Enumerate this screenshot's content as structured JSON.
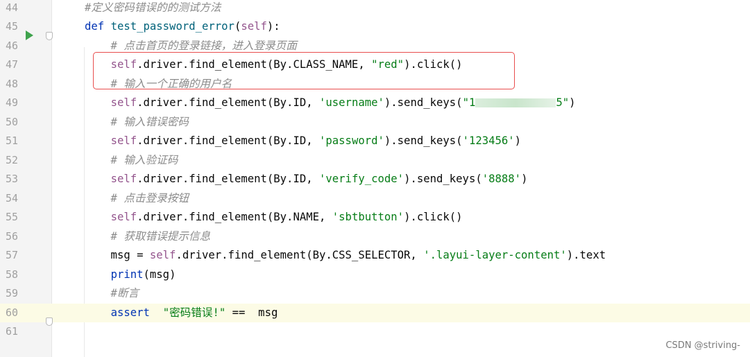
{
  "lines": [
    {
      "num": "44",
      "tokens": [
        {
          "t": "#定义密码错误的的测试方法",
          "c": "cmt"
        }
      ]
    },
    {
      "num": "45",
      "tokens": [
        {
          "t": "def ",
          "c": "kw"
        },
        {
          "t": "test_password_error",
          "c": "fn"
        },
        {
          "t": "(",
          "c": ""
        },
        {
          "t": "self",
          "c": "slf"
        },
        {
          "t": "):",
          "c": ""
        }
      ]
    },
    {
      "num": "46",
      "tokens": [
        {
          "t": "    # 点击首页的登录链接，进入登录页面",
          "c": "cmt"
        }
      ]
    },
    {
      "num": "47",
      "tokens": [
        {
          "t": "    ",
          "c": ""
        },
        {
          "t": "self",
          "c": "slf"
        },
        {
          "t": ".driver.find_element(By.CLASS_NAME, ",
          "c": ""
        },
        {
          "t": "\"red\"",
          "c": "str"
        },
        {
          "t": ").click()",
          "c": ""
        }
      ]
    },
    {
      "num": "48",
      "tokens": [
        {
          "t": "    # 输入一个正确的用户名",
          "c": "cmt"
        }
      ]
    },
    {
      "num": "49",
      "tokens": [
        {
          "t": "    ",
          "c": ""
        },
        {
          "t": "self",
          "c": "slf"
        },
        {
          "t": ".driver.find_element(By.ID, ",
          "c": ""
        },
        {
          "t": "'username'",
          "c": "str"
        },
        {
          "t": ").send_keys(",
          "c": ""
        },
        {
          "t": "\"1",
          "c": "str"
        },
        {
          "t": "",
          "c": "blur"
        },
        {
          "t": "5\"",
          "c": "str"
        },
        {
          "t": ")",
          "c": ""
        }
      ]
    },
    {
      "num": "50",
      "tokens": [
        {
          "t": "    # 输入错误密码",
          "c": "cmt"
        }
      ]
    },
    {
      "num": "51",
      "tokens": [
        {
          "t": "    ",
          "c": ""
        },
        {
          "t": "self",
          "c": "slf"
        },
        {
          "t": ".driver.find_element(By.ID, ",
          "c": ""
        },
        {
          "t": "'password'",
          "c": "str"
        },
        {
          "t": ").send_keys(",
          "c": ""
        },
        {
          "t": "'123456'",
          "c": "str"
        },
        {
          "t": ")",
          "c": ""
        }
      ]
    },
    {
      "num": "52",
      "tokens": [
        {
          "t": "    # 输入验证码",
          "c": "cmt"
        }
      ]
    },
    {
      "num": "53",
      "tokens": [
        {
          "t": "    ",
          "c": ""
        },
        {
          "t": "self",
          "c": "slf"
        },
        {
          "t": ".driver.find_element(By.ID, ",
          "c": ""
        },
        {
          "t": "'verify_code'",
          "c": "str"
        },
        {
          "t": ").send_keys(",
          "c": ""
        },
        {
          "t": "'8888'",
          "c": "str"
        },
        {
          "t": ")",
          "c": ""
        }
      ]
    },
    {
      "num": "54",
      "tokens": [
        {
          "t": "    # 点击登录按钮",
          "c": "cmt"
        }
      ]
    },
    {
      "num": "55",
      "tokens": [
        {
          "t": "    ",
          "c": ""
        },
        {
          "t": "self",
          "c": "slf"
        },
        {
          "t": ".driver.find_element(By.NAME, ",
          "c": ""
        },
        {
          "t": "'sbtbutton'",
          "c": "str"
        },
        {
          "t": ").click()",
          "c": ""
        }
      ]
    },
    {
      "num": "56",
      "tokens": [
        {
          "t": "    # 获取错误提示信息",
          "c": "cmt"
        }
      ]
    },
    {
      "num": "57",
      "tokens": [
        {
          "t": "    msg = ",
          "c": ""
        },
        {
          "t": "self",
          "c": "slf"
        },
        {
          "t": ".driver.find_element(By.CSS_SELECTOR, ",
          "c": ""
        },
        {
          "t": "'.layui-layer-content'",
          "c": "str"
        },
        {
          "t": ").text",
          "c": ""
        }
      ]
    },
    {
      "num": "58",
      "tokens": [
        {
          "t": "    ",
          "c": ""
        },
        {
          "t": "print",
          "c": "kw"
        },
        {
          "t": "(msg)",
          "c": ""
        }
      ]
    },
    {
      "num": "59",
      "tokens": [
        {
          "t": "    #断言",
          "c": "cmt"
        }
      ]
    },
    {
      "num": "60",
      "tokens": [
        {
          "t": "    ",
          "c": ""
        },
        {
          "t": "assert",
          "c": "kw"
        },
        {
          "t": "  ",
          "c": ""
        },
        {
          "t": "\"密码错误!\"",
          "c": "str"
        },
        {
          "t": " ==  msg",
          "c": ""
        }
      ]
    },
    {
      "num": "61",
      "tokens": []
    }
  ],
  "current_line": "60",
  "watermark": "CSDN @striving-",
  "colors": {
    "highlight_box": "#e84d4d",
    "run_icon": "#3fa34d"
  }
}
